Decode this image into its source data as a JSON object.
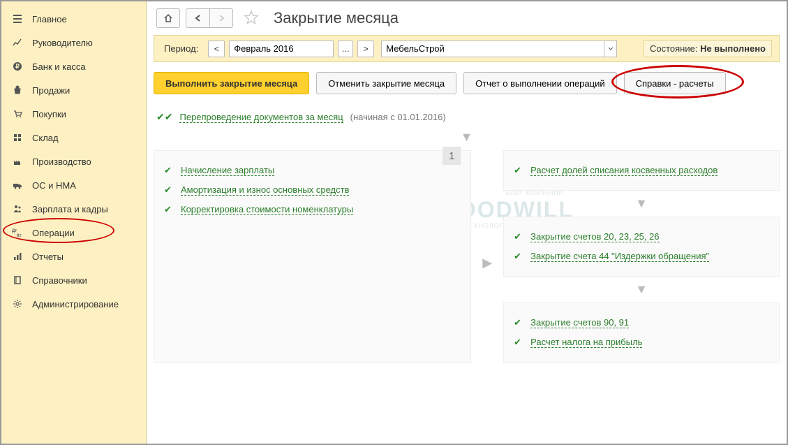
{
  "sidebar": {
    "items": [
      {
        "label": "Главное",
        "icon": "menu"
      },
      {
        "label": "Руководителю",
        "icon": "chart"
      },
      {
        "label": "Банк и касса",
        "icon": "ruble"
      },
      {
        "label": "Продажи",
        "icon": "bag"
      },
      {
        "label": "Покупки",
        "icon": "cart"
      },
      {
        "label": "Склад",
        "icon": "boxes"
      },
      {
        "label": "Производство",
        "icon": "factory"
      },
      {
        "label": "ОС и НМА",
        "icon": "truck"
      },
      {
        "label": "Зарплата и кадры",
        "icon": "people"
      },
      {
        "label": "Операции",
        "icon": "dtكt"
      },
      {
        "label": "Отчеты",
        "icon": "bars"
      },
      {
        "label": "Справочники",
        "icon": "book"
      },
      {
        "label": "Администрирование",
        "icon": "gear"
      }
    ]
  },
  "header": {
    "title": "Закрытие месяца"
  },
  "period": {
    "label": "Период:",
    "month": "Февраль 2016",
    "org": "МебельСтрой",
    "state_label": "Состояние:",
    "state_value": "Не выполнено"
  },
  "actions": {
    "execute": "Выполнить закрытие месяца",
    "cancel": "Отменить закрытие месяца",
    "report": "Отчет о выполнении операций",
    "refs": "Справки - расчеты"
  },
  "repost": {
    "link": "Перепроведение документов за месяц",
    "note": "(начиная с 01.01.2016)"
  },
  "badge": "1",
  "left_ops": [
    "Начисление зарплаты",
    "Амортизация и износ основных средств",
    "Корректировка стоимости номенклатуры"
  ],
  "right_blocks": [
    [
      "Расчет долей списания косвенных расходов"
    ],
    [
      "Закрытие счетов 20, 23, 25, 26",
      "Закрытие счета 44 \"Издержки обращения\""
    ],
    [
      "Закрытие счетов 90, 91",
      "Расчет налога на прибыль"
    ]
  ],
  "watermark": {
    "main": "GOODWILL",
    "sub": "ТЕХНОЛОГИИ ДЛЯ БИЗНЕСА",
    "top": "БЛОГ КОМПАНИИ"
  }
}
